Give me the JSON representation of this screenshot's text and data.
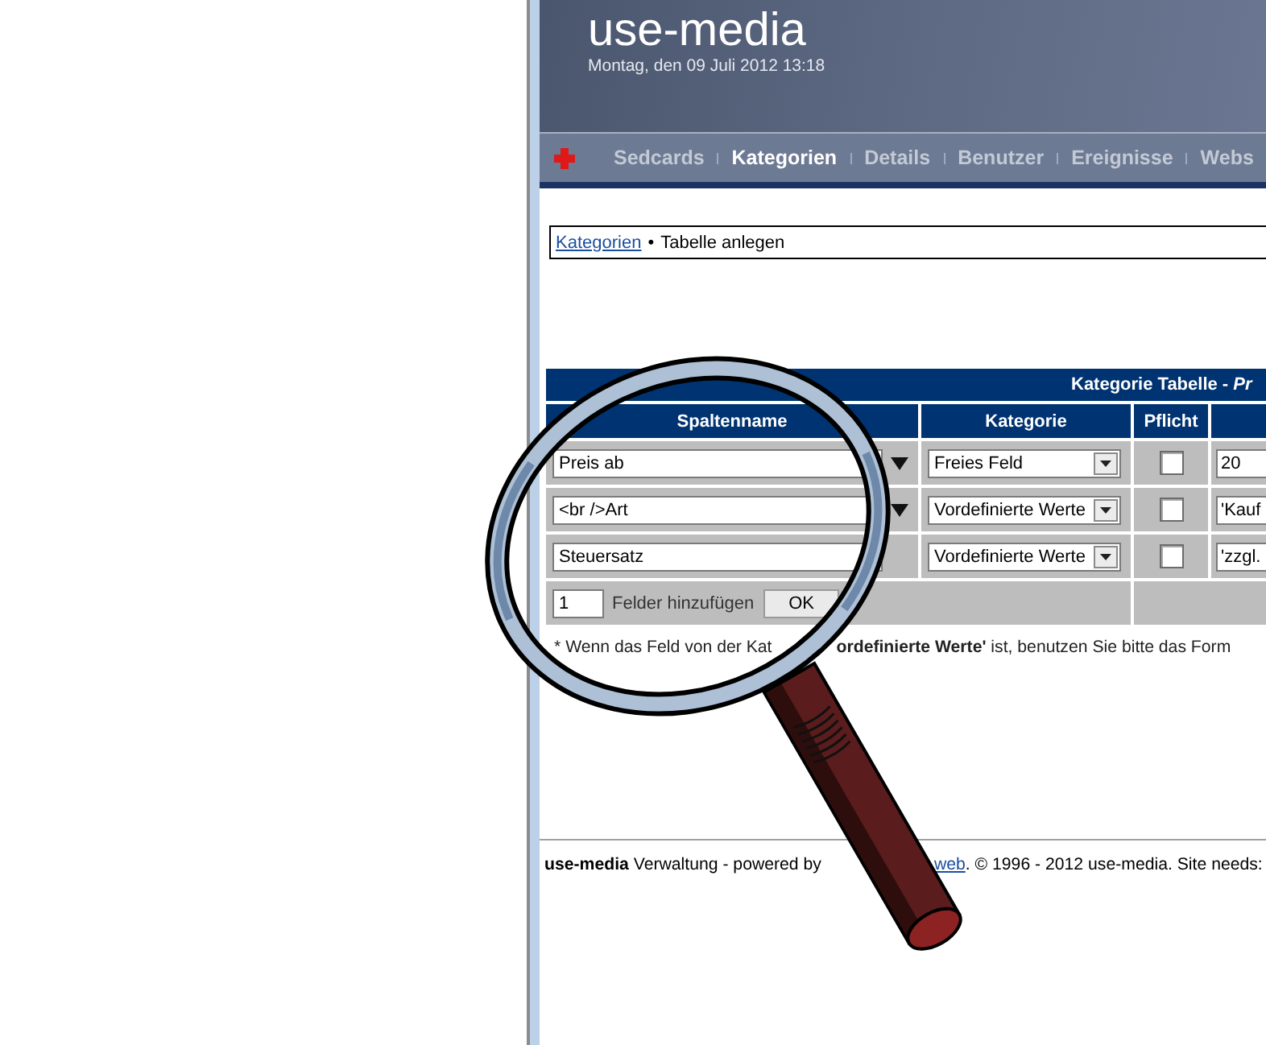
{
  "header": {
    "title": "use-media",
    "date": "Montag, den 09 Juli 2012 13:18"
  },
  "nav": {
    "items": [
      {
        "label": "Sedcards",
        "selected": false
      },
      {
        "label": "Kategorien",
        "selected": true
      },
      {
        "label": "Details",
        "selected": false
      },
      {
        "label": "Benutzer",
        "selected": false
      },
      {
        "label": "Ereignisse",
        "selected": false
      },
      {
        "label": "Webs",
        "selected": false
      }
    ]
  },
  "breadcrumb": {
    "link": "Kategorien",
    "separator": "•",
    "current": "Tabelle anlegen"
  },
  "table": {
    "title": "Kategorie Tabelle - *Pr*",
    "columns": [
      "Spaltenname",
      "Kategorie",
      "Pflicht"
    ],
    "rows": [
      {
        "name": "Preis ab",
        "menu_arrow": true,
        "category": "Freies Feld",
        "required": false,
        "column_4": "20"
      },
      {
        "name": "<br />Art",
        "menu_arrow": true,
        "category": "Vordefinierte Werte",
        "required": false,
        "column_4": "'Kauf"
      },
      {
        "name": "Steuersatz",
        "menu_arrow": false,
        "category": "Vordefinierte Werte",
        "required": false,
        "column_4": "'zzgl."
      }
    ],
    "add_fields": {
      "count": "1",
      "label": "Felder hinzufügen",
      "button": "OK"
    }
  },
  "note": {
    "part_1": "* Wenn das Feld von der Kat",
    "part_2": "**ordefinierte Werte'** ist, benutzen Sie bitte das Form"
  },
  "footer": {
    "text": "**use-media** Verwaltung - powered by",
    "link": "web",
    "rest": ". © 1996 - 2012 use-media. Site needs:"
  }
}
